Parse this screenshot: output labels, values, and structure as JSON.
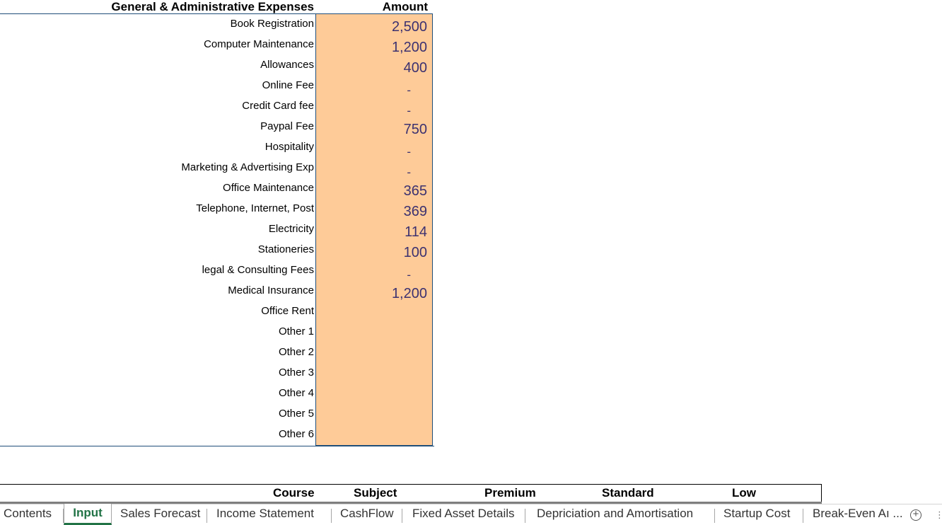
{
  "expenses_table": {
    "header_label": "General & Administrative Expenses",
    "header_amount": "Amount",
    "rows": [
      {
        "label": "Book Registration",
        "amount": "2,500"
      },
      {
        "label": "Computer Maintenance",
        "amount": "1,200"
      },
      {
        "label": "Allowances",
        "amount": "400"
      },
      {
        "label": "Online Fee",
        "amount": "-"
      },
      {
        "label": "Credit Card fee",
        "amount": "-"
      },
      {
        "label": "Paypal Fee",
        "amount": "750"
      },
      {
        "label": "Hospitality",
        "amount": "-"
      },
      {
        "label": "Marketing & Advertising Exp",
        "amount": "-"
      },
      {
        "label": "Office Maintenance",
        "amount": "365"
      },
      {
        "label": "Telephone, Internet, Post",
        "amount": "369"
      },
      {
        "label": "Electricity",
        "amount": "114"
      },
      {
        "label": "Stationeries",
        "amount": "100"
      },
      {
        "label": "legal & Consulting Fees",
        "amount": "-"
      },
      {
        "label": "Medical Insurance",
        "amount": "1,200"
      },
      {
        "label": "Office Rent",
        "amount": ""
      },
      {
        "label": "Other 1",
        "amount": ""
      },
      {
        "label": "Other 2",
        "amount": ""
      },
      {
        "label": "Other 3",
        "amount": ""
      },
      {
        "label": "Other 4",
        "amount": ""
      },
      {
        "label": "Other 5",
        "amount": ""
      },
      {
        "label": "Other 6",
        "amount": ""
      }
    ]
  },
  "pricing_table": {
    "headers": [
      "Course",
      "Subject",
      "Premium",
      "Standard",
      "Low"
    ]
  },
  "tabs": [
    {
      "label": "Contents",
      "active": false
    },
    {
      "label": "Input",
      "active": true
    },
    {
      "label": "Sales Forecast",
      "active": false
    },
    {
      "label": "Income Statement",
      "active": false
    },
    {
      "label": "CashFlow",
      "active": false
    },
    {
      "label": "Fixed Asset Details",
      "active": false
    },
    {
      "label": "Depriciation and Amortisation",
      "active": false
    },
    {
      "label": "Startup Cost",
      "active": false
    },
    {
      "label": "Break-Even Aı ...",
      "active": false
    }
  ],
  "tabbar": {
    "add_glyph": "+",
    "more_glyph": "⋮"
  },
  "colors": {
    "input_fill": "#fecb98",
    "amount_text": "#3c3170",
    "active_tab": "#217346",
    "border": "#1f4e79"
  },
  "icons": {
    "add_sheet": "plus-circle-icon",
    "more": "vertical-ellipsis-icon"
  }
}
